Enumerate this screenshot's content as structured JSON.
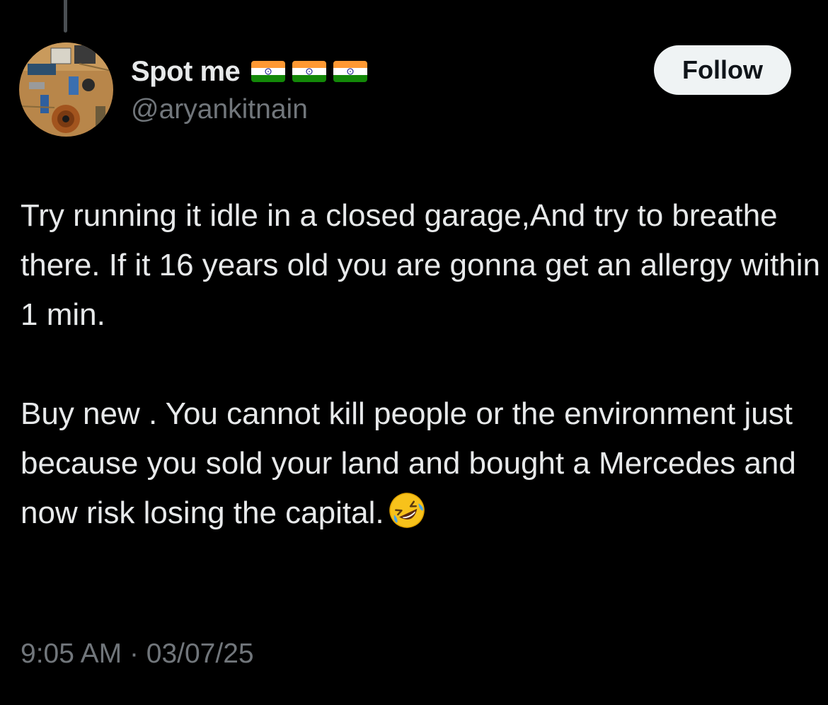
{
  "tweet": {
    "author": {
      "display_name": "Spot me",
      "handle": "@aryankitnain",
      "flags": [
        "india-flag",
        "india-flag",
        "india-flag"
      ],
      "avatar": "circuit-board-photo"
    },
    "follow_label": "Follow",
    "paragraphs": [
      "Try running it idle in a closed garage,And try to breathe there. If it 16 years old you are gonna get an allergy within 1 min.",
      "Buy new . You cannot kill people or the environment just because you sold your land and bought a Mercedes and now risk losing the capital."
    ],
    "trailing_emoji": "rolling-on-floor-laughing-emoji",
    "time": "9:05 AM",
    "separator": "·",
    "date": "03/07/25"
  },
  "colors": {
    "background": "#000000",
    "primary_text": "#e7e9ea",
    "secondary_text": "#71767b",
    "follow_button_bg": "#eff3f4",
    "follow_button_text": "#0f1419"
  }
}
